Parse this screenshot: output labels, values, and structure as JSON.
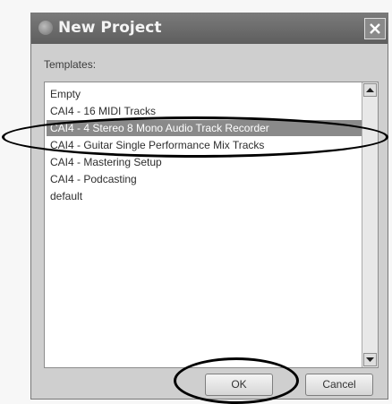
{
  "dialog": {
    "title": "New Project",
    "templates_label": "Templates:",
    "list_items": [
      "Empty",
      "CAI4 - 16 MIDI Tracks",
      "CAI4 - 4 Stereo 8 Mono Audio Track Recorder",
      "CAI4 - Guitar Single Performance Mix Tracks",
      "CAI4 - Mastering Setup",
      "CAI4 - Podcasting",
      "default"
    ],
    "selected_index": 2,
    "ok_label": "OK",
    "cancel_label": "Cancel"
  },
  "icons": {
    "window_icon": "app-icon",
    "close": "close-icon",
    "scroll_up": "chevron-up-icon",
    "scroll_down": "chevron-down-icon"
  },
  "colors": {
    "titlebar": "#6a6a6a",
    "selection": "#8a8a8a",
    "highlight_ring": "#000000"
  }
}
